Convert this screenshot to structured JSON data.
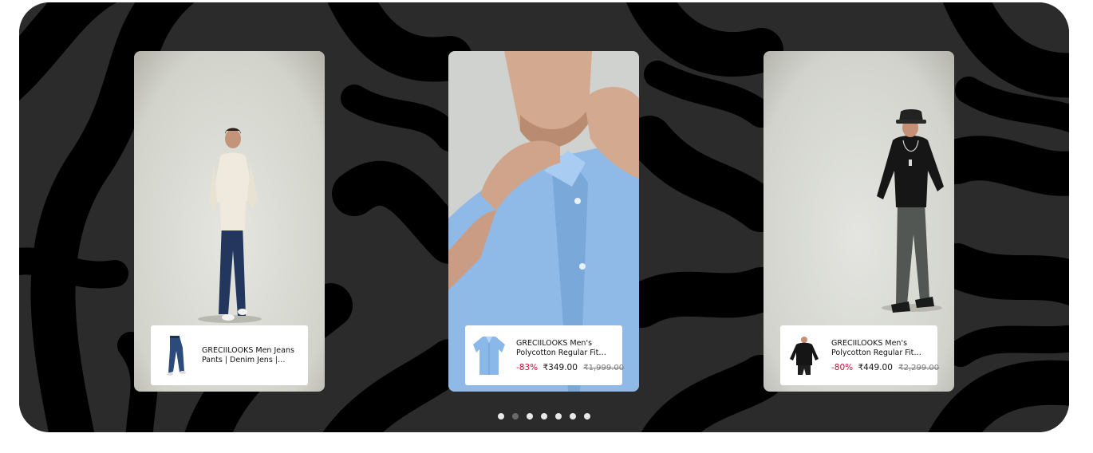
{
  "carousel": {
    "cards": [
      {
        "photo_icon": "man-walking-cream-shirt-jeans-photo",
        "thumb_icon": "jeans-thumbnail-icon",
        "title": "GRECIILOOKS Men Jeans Pants | Denim Jens | Baggy Sty for Ma...",
        "discount": "",
        "price": "",
        "mrp": ""
      },
      {
        "photo_icon": "man-blue-shirt-closeup-photo",
        "thumb_icon": "blue-shirt-thumbnail-icon",
        "title": "GRECIILOOKS Men's Polycotton Regular Fit Casual Shirt | Stylis...",
        "discount": "-83%",
        "price": "₹349.00",
        "mrp": "₹1,999.00"
      },
      {
        "photo_icon": "man-black-sweatshirt-bucket-hat-photo",
        "thumb_icon": "black-sweatshirt-thumbnail-icon",
        "title": "GRECIILOOKS Men's Polycotton Regular Fit Solid Plain Casual ...",
        "discount": "-80%",
        "price": "₹449.00",
        "mrp": "₹2,299.00"
      }
    ],
    "pagination": {
      "total": 7,
      "active_index": 1
    }
  }
}
